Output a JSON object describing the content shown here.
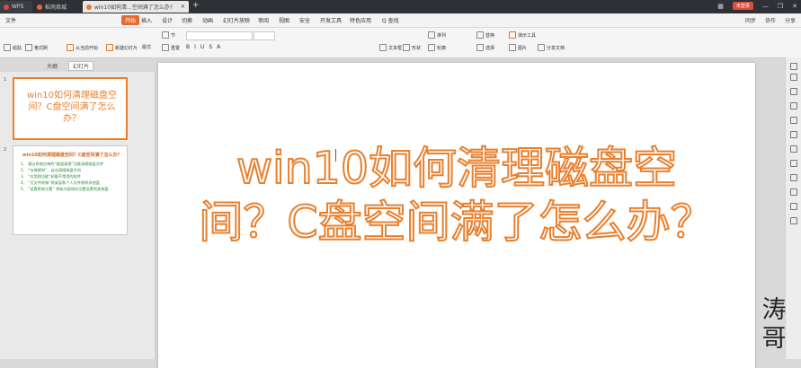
{
  "titlebar": {
    "tabs": [
      {
        "label": "WPS"
      },
      {
        "label": "稻壳商城"
      },
      {
        "label": "win10如何清...空间满了怎么办?"
      }
    ],
    "login": "未登录"
  },
  "menubar": {
    "items": [
      "文件",
      "开始",
      "插入",
      "设计",
      "切换",
      "动画",
      "幻灯片放映",
      "审阅",
      "视图",
      "安全",
      "开发工具",
      "特色应用",
      "Q 查找"
    ],
    "right": [
      "同步",
      "协作",
      "分享"
    ]
  },
  "ribbon": {
    "groups": [
      "粘贴",
      "格式刷",
      "从当前开始",
      "新建幻灯片",
      "版式",
      "节",
      "重置",
      "文本框",
      "形状",
      "排列",
      "轮廓",
      "替换",
      "选择",
      "图片",
      "演示工具",
      "分享文档"
    ]
  },
  "panel": {
    "tabs": [
      "大纲",
      "幻灯片"
    ],
    "slide1_title": "win10如何清理磁盘空间？C盘空间满了怎么办？",
    "slide2_heading": "win10如何清理磁盘空间？C盘空间满了怎么办？",
    "slide2_items": [
      "1、 通过系统自带的“磁盘清理”功能清理磁盘文件",
      "2、 “存储感知”，自动清理磁盘空间",
      "3、 “应用和功能”卸载不常用的软件",
      "4、 “大文件转移”将桌面和个人文件移到其他盘",
      "5、 “设置更改位置” 将新内容保存位置设置到其他盘"
    ]
  },
  "slide": {
    "title": "win10如何清理磁盘空间？C盘空间满了怎么办？"
  },
  "watermark": "涛哥",
  "colors": {
    "accent": "#e8802e",
    "tabbar": "#2f3136"
  }
}
